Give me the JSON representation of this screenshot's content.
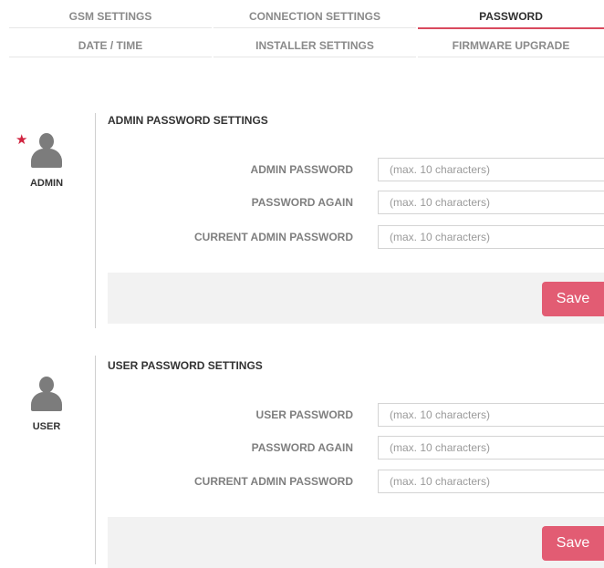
{
  "tabs": {
    "row1": [
      "GSM SETTINGS",
      "CONNECTION SETTINGS",
      "PASSWORD"
    ],
    "row2": [
      "DATE / TIME",
      "INSTALLER SETTINGS",
      "FIRMWARE UPGRADE"
    ],
    "active": "PASSWORD"
  },
  "accent_color": "#e25c73",
  "star_color": "#d0233f",
  "admin": {
    "role": "ADMIN",
    "title": "ADMIN PASSWORD SETTINGS",
    "fields": [
      {
        "label": "ADMIN PASSWORD",
        "placeholder": "(max. 10 characters)",
        "value": ""
      },
      {
        "label": "PASSWORD AGAIN",
        "placeholder": "(max. 10 characters)",
        "value": ""
      },
      {
        "label": "CURRENT ADMIN PASSWORD",
        "placeholder": "(max. 10 characters)",
        "value": ""
      }
    ],
    "save_label": "Save"
  },
  "user": {
    "role": "USER",
    "title": "USER PASSWORD SETTINGS",
    "fields": [
      {
        "label": "USER PASSWORD",
        "placeholder": "(max. 10 characters)",
        "value": ""
      },
      {
        "label": "PASSWORD AGAIN",
        "placeholder": "(max. 10 characters)",
        "value": ""
      },
      {
        "label": "CURRENT ADMIN PASSWORD",
        "placeholder": "(max. 10 characters)",
        "value": ""
      }
    ],
    "save_label": "Save"
  }
}
